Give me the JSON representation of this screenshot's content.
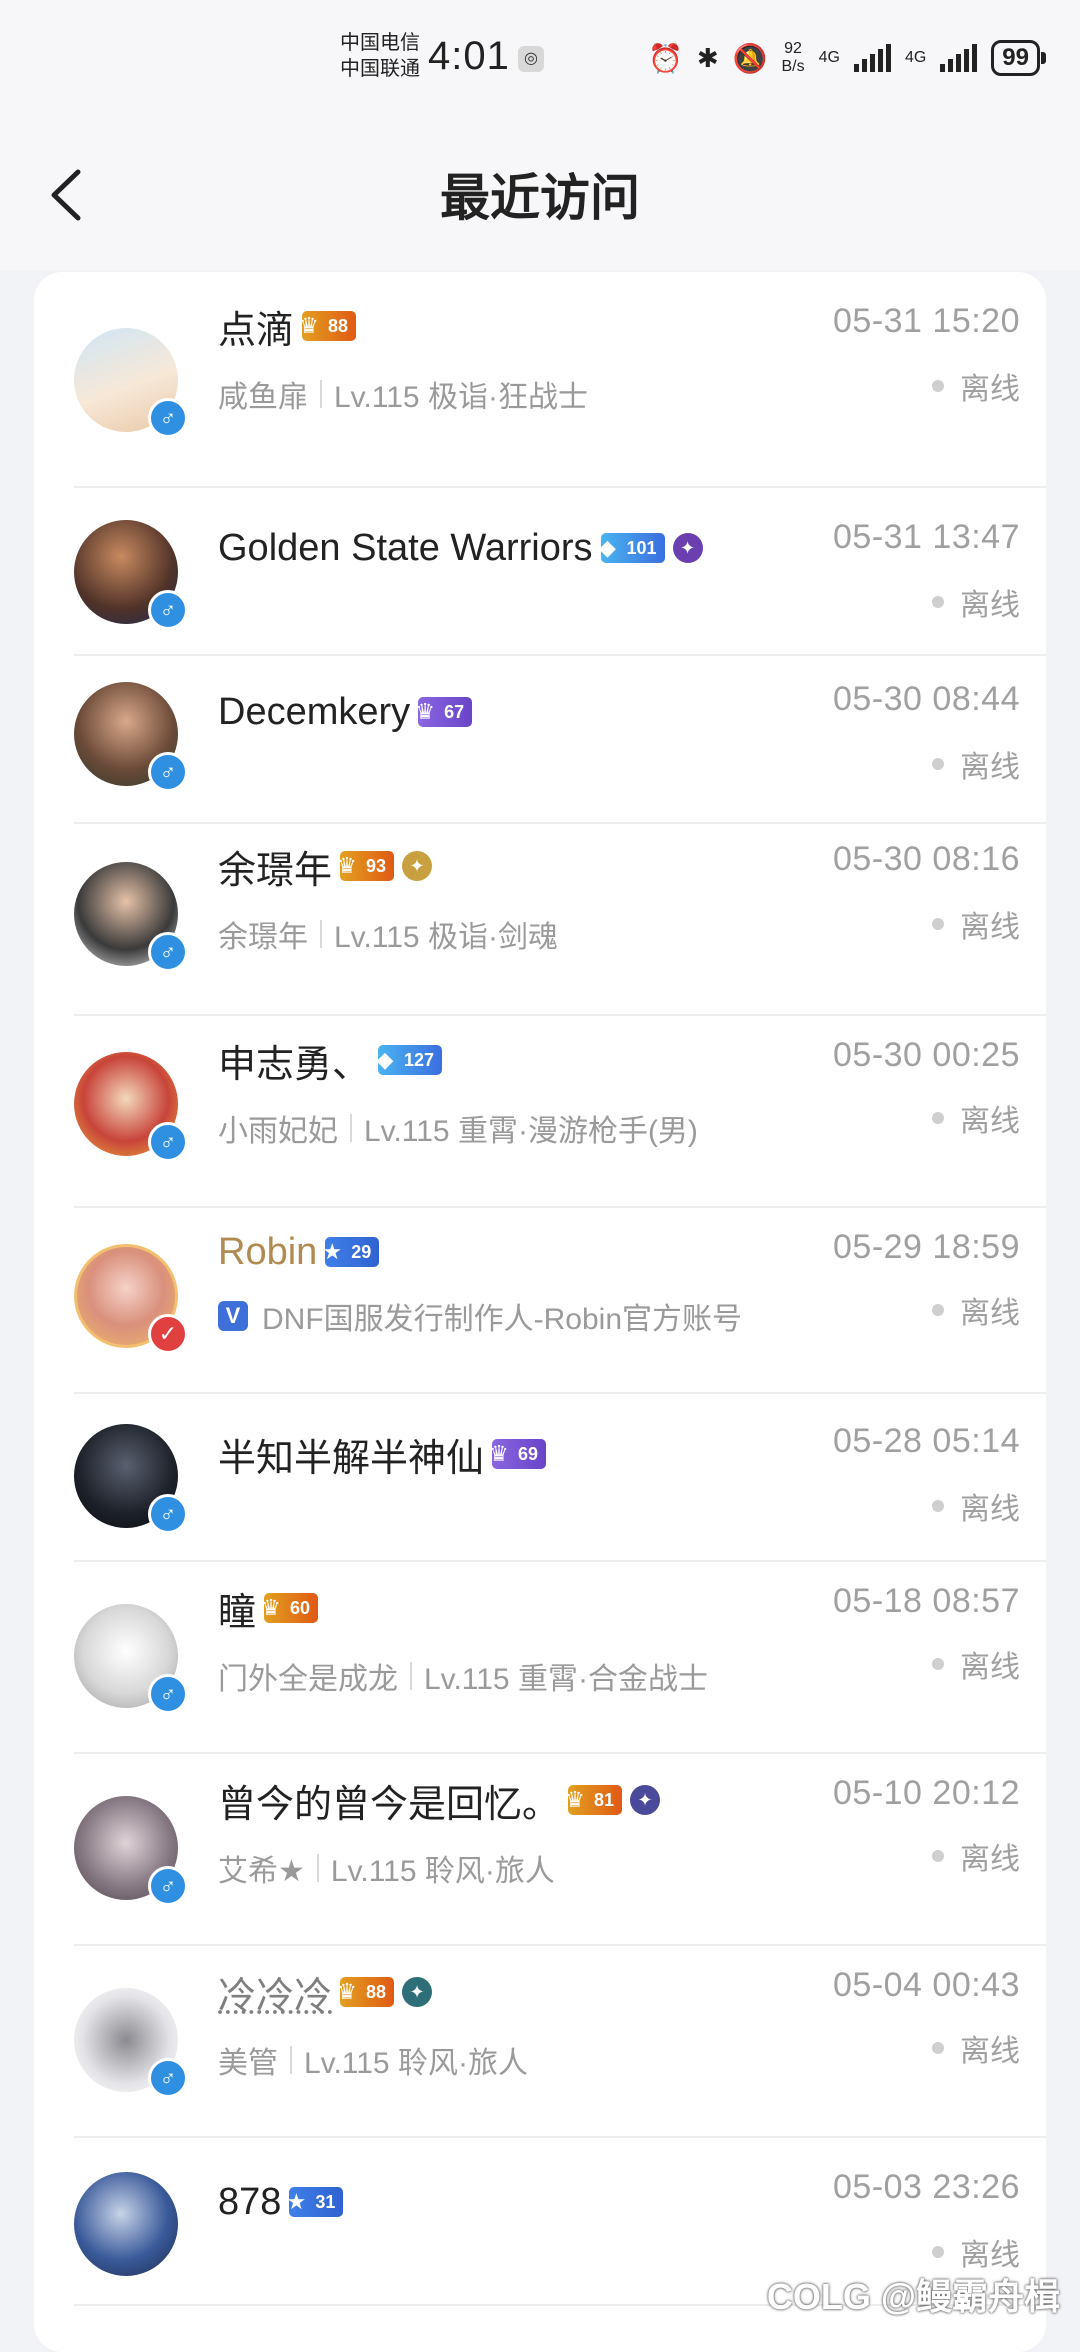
{
  "status_bar": {
    "carrier1": "中国电信",
    "carrier2": "中国联通",
    "time": "4:01",
    "net_speed_value": "92",
    "net_speed_unit": "B/s",
    "net1": "4G",
    "net2": "4G",
    "battery": "99"
  },
  "nav": {
    "title": "最近访问"
  },
  "colors": {
    "gender_blue": "#2f8fe0",
    "verified_blue": "#3f6fd8",
    "gold_name": "#b08a50"
  },
  "visitors": [
    {
      "name": "点滴",
      "badge": "88",
      "badge_style": "orange",
      "subtitle_name": "咸鱼扉",
      "subtitle_level": "Lv.115 极诣·狂战士",
      "time": "05-31 15:20",
      "status": "离线",
      "extra_rank": false
    },
    {
      "name": "Golden State Warriors",
      "badge": "101",
      "badge_style": "sky",
      "subtitle_name": "",
      "subtitle_level": "",
      "time": "05-31 13:47",
      "status": "离线",
      "extra_rank": true
    },
    {
      "name": "Decemkery",
      "badge": "67",
      "badge_style": "purple",
      "subtitle_name": "",
      "subtitle_level": "",
      "time": "05-30 08:44",
      "status": "离线",
      "extra_rank": false
    },
    {
      "name": "余璟年",
      "badge": "93",
      "badge_style": "orange",
      "subtitle_name": "余璟年",
      "subtitle_level": "Lv.115 极诣·剑魂",
      "time": "05-30 08:16",
      "status": "离线",
      "extra_rank": true
    },
    {
      "name": "申志勇、",
      "badge": "127",
      "badge_style": "sky",
      "subtitle_name": "小雨妃妃",
      "subtitle_level": "Lv.115 重霄·漫游枪手(男)",
      "time": "05-30 00:25",
      "status": "离线",
      "extra_rank": false
    },
    {
      "name": "Robin",
      "badge": "29",
      "badge_style": "blue",
      "verified_text": "DNF国服发行制作人-Robin官方账号",
      "verified_label": "V",
      "time": "05-29 18:59",
      "status": "离线",
      "extra_rank": false
    },
    {
      "name": "半知半解半神仙",
      "badge": "69",
      "badge_style": "purple",
      "subtitle_name": "",
      "subtitle_level": "",
      "time": "05-28 05:14",
      "status": "离线",
      "extra_rank": false
    },
    {
      "name": "瞳",
      "badge": "60",
      "badge_style": "orange",
      "subtitle_name": "门外全是成龙",
      "subtitle_level": "Lv.115 重霄·合金战士",
      "time": "05-18 08:57",
      "status": "离线",
      "extra_rank": false
    },
    {
      "name": "曾今的曾今是回忆。",
      "badge": "81",
      "badge_style": "orange",
      "subtitle_name": "艾希★",
      "subtitle_level": "Lv.115 聆风·旅人",
      "time": "05-10 20:12",
      "status": "离线",
      "extra_rank": true
    },
    {
      "name": "冷冷冷",
      "badge": "88",
      "badge_style": "orange",
      "subtitle_name": "美管",
      "subtitle_level": "Lv.115 聆风·旅人",
      "time": "05-04 00:43",
      "status": "离线",
      "extra_rank": true
    },
    {
      "name": "878",
      "badge": "31",
      "badge_style": "blue",
      "subtitle_name": "",
      "subtitle_level": "",
      "time": "05-03 23:26",
      "status": "离线",
      "extra_rank": false
    }
  ],
  "gender_symbol": "♂",
  "watermark": "COLG @鳗霸舟楫"
}
